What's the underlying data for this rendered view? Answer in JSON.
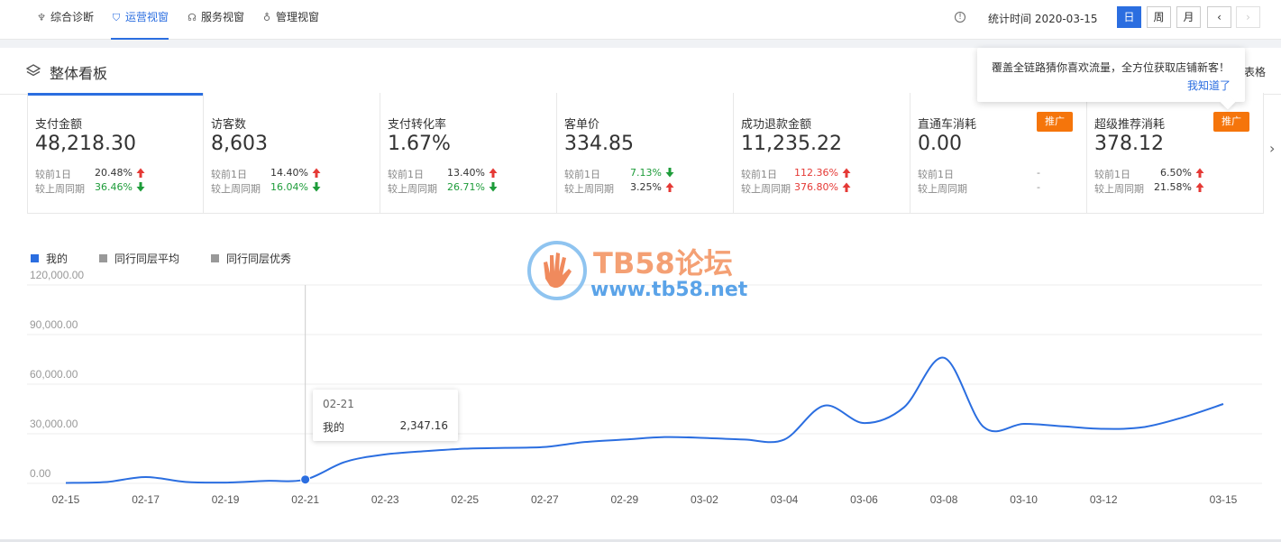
{
  "nav": {
    "tabs": [
      {
        "label": "综合诊断",
        "icon": "diagnosis-icon",
        "active": false
      },
      {
        "label": "运营视窗",
        "icon": "shield-icon",
        "active": true
      },
      {
        "label": "服务视窗",
        "icon": "headset-icon",
        "active": false
      },
      {
        "label": "管理视窗",
        "icon": "medal-icon",
        "active": false
      }
    ],
    "stat_time": "统计时间 2020-03-15",
    "period_buttons": [
      "日",
      "周",
      "月"
    ],
    "active_period": "日",
    "prev": "‹",
    "next": "›"
  },
  "panel": {
    "title": "整体看板",
    "side_text": "表格",
    "popover": {
      "message": "覆盖全链路猜你喜欢流量，全方位获取店铺新客！",
      "action": "我知道了"
    }
  },
  "metrics": [
    {
      "label": "支付金额",
      "value": "48,218.30",
      "active": true,
      "promo": null,
      "cmp1_label": "较前1日",
      "cmp1": "20.48%",
      "cmp1_dir": "up",
      "cmp2_label": "较上周同期",
      "cmp2": "36.46%",
      "cmp2_dir": "down"
    },
    {
      "label": "访客数",
      "value": "8,603",
      "active": false,
      "promo": null,
      "cmp1_label": "较前1日",
      "cmp1": "14.40%",
      "cmp1_dir": "up",
      "cmp2_label": "较上周同期",
      "cmp2": "16.04%",
      "cmp2_dir": "down"
    },
    {
      "label": "支付转化率",
      "value": "1.67%",
      "active": false,
      "promo": null,
      "cmp1_label": "较前1日",
      "cmp1": "13.40%",
      "cmp1_dir": "up",
      "cmp2_label": "较上周同期",
      "cmp2": "26.71%",
      "cmp2_dir": "down"
    },
    {
      "label": "客单价",
      "value": "334.85",
      "active": false,
      "promo": null,
      "cmp1_label": "较前1日",
      "cmp1": "7.13%",
      "cmp1_dir": "down",
      "cmp2_label": "较上周同期",
      "cmp2": "3.25%",
      "cmp2_dir": "up"
    },
    {
      "label": "成功退款金额",
      "value": "11,235.22",
      "active": false,
      "promo": null,
      "cmp1_label": "较前1日",
      "cmp1": "112.36%",
      "cmp1_dir": "up-red",
      "cmp2_label": "较上周同期",
      "cmp2": "376.80%",
      "cmp2_dir": "up-red"
    },
    {
      "label": "直通车消耗",
      "value": "0.00",
      "active": false,
      "promo": "推广",
      "cmp1_label": "较前1日",
      "cmp1": "-",
      "cmp1_dir": "none",
      "cmp2_label": "较上周同期",
      "cmp2": "-",
      "cmp2_dir": "none"
    },
    {
      "label": "超级推荐消耗",
      "value": "378.12",
      "active": false,
      "promo": "推广",
      "cmp1_label": "较前1日",
      "cmp1": "6.50%",
      "cmp1_dir": "up",
      "cmp2_label": "较上周同期",
      "cmp2": "21.58%",
      "cmp2_dir": "up"
    }
  ],
  "legend": [
    {
      "name": "我的",
      "color": "#2b6ee0"
    },
    {
      "name": "同行同层平均",
      "color": "#999999"
    },
    {
      "name": "同行同层优秀",
      "color": "#999999"
    }
  ],
  "watermark": {
    "line1": "TB58论坛",
    "line2": "www.tb58.net"
  },
  "hover_tooltip": {
    "date": "02-21",
    "series": "我的",
    "value": "2,347.16"
  },
  "chart_data": {
    "type": "line",
    "x_ticks": [
      "02-15",
      "02-17",
      "02-19",
      "02-21",
      "02-23",
      "02-25",
      "02-27",
      "02-29",
      "03-02",
      "03-04",
      "03-06",
      "03-08",
      "03-10",
      "03-12",
      "03-15"
    ],
    "y_ticks": [
      "120,000.00",
      "90,000.00",
      "60,000.00",
      "30,000.00",
      "0.00"
    ],
    "ylim": [
      0,
      120000
    ],
    "x": [
      "02-15",
      "02-16",
      "02-17",
      "02-18",
      "02-19",
      "02-20",
      "02-21",
      "02-22",
      "02-23",
      "02-24",
      "02-25",
      "02-26",
      "02-27",
      "02-28",
      "02-29",
      "03-01",
      "03-02",
      "03-03",
      "03-04",
      "03-05",
      "03-06",
      "03-07",
      "03-08",
      "03-09",
      "03-10",
      "03-11",
      "03-12",
      "03-13",
      "03-14",
      "03-15"
    ],
    "series": [
      {
        "name": "我的",
        "color": "#2b6ee0",
        "values": [
          300,
          800,
          3800,
          900,
          500,
          1500,
          2347,
          13000,
          17500,
          19500,
          21000,
          21500,
          22000,
          25000,
          26500,
          28000,
          27500,
          26500,
          26500,
          47000,
          36500,
          46000,
          76000,
          34000,
          36000,
          34500,
          33000,
          34000,
          40000,
          48000
        ]
      }
    ],
    "highlight_index": 6
  }
}
